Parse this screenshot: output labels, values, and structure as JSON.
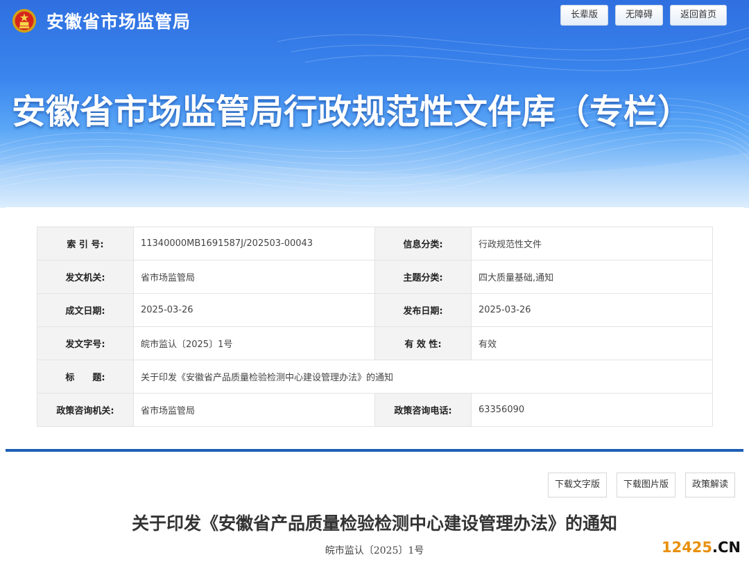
{
  "header": {
    "site_name": "安徽省市场监管局",
    "buttons": [
      "长辈版",
      "无障碍",
      "返回首页"
    ],
    "banner_title": "安徽省市场监管局行政规范性文件库（专栏）",
    "colors": {
      "banner_primary": "#2f6fe0",
      "banner_light": "#d9ecfd"
    }
  },
  "meta": {
    "rows": [
      {
        "l1": "索 引 号:",
        "v1": "11340000MB1691587J/202503-00043",
        "l2": "信息分类:",
        "v2": "行政规范性文件"
      },
      {
        "l1": "发文机关:",
        "v1": "省市场监管局",
        "l2": "主题分类:",
        "v2": "四大质量基础,通知"
      },
      {
        "l1": "成文日期:",
        "v1": "2025-03-26",
        "l2": "发布日期:",
        "v2": "2025-03-26"
      },
      {
        "l1": "发文字号:",
        "v1": "皖市监认〔2025〕1号",
        "l2": "有 效 性:",
        "v2": "有效"
      }
    ],
    "title_label": "标　　题:",
    "title_value": "关于印发《安徽省产品质量检验检测中心建设管理办法》的通知",
    "consult": {
      "l1": "政策咨询机关:",
      "v1": "省市场监管局",
      "l2": "政策咨询电话:",
      "v2": "63356090"
    }
  },
  "doc": {
    "buttons": [
      "下载文字版",
      "下载图片版",
      "政策解读"
    ],
    "title": "关于印发《安徽省产品质量检验检测中心建设管理办法》的通知",
    "number": "皖市监认〔2025〕1号",
    "divider_color": "#1d5eb5"
  },
  "watermark": {
    "num": "12425",
    "domain": ".CN"
  }
}
